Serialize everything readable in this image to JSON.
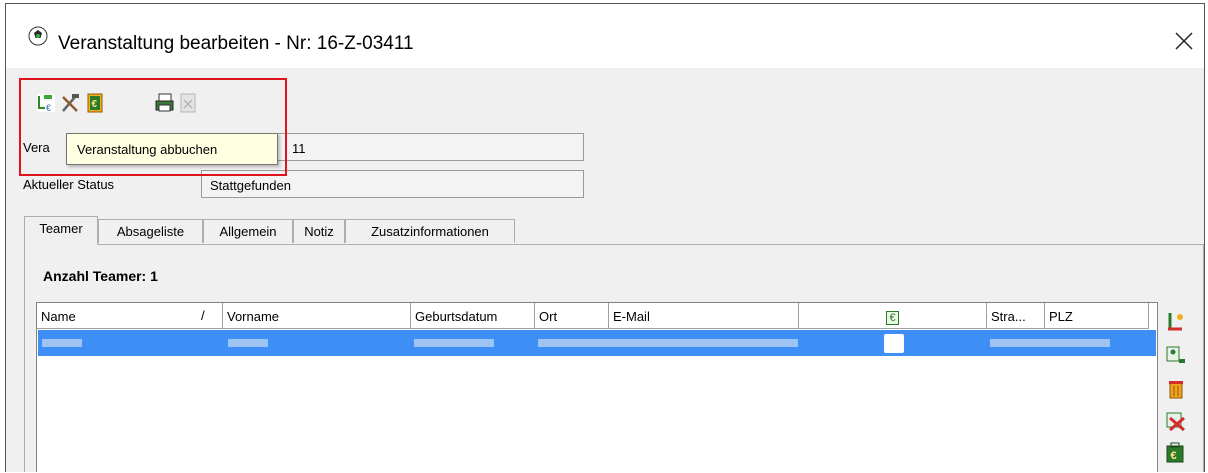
{
  "window": {
    "title": "Veranstaltung bearbeiten - Nr: 16-Z-03411",
    "close_icon": "close-icon"
  },
  "toolbar": {
    "icons": [
      "book-event-icon",
      "tools-icon",
      "euro-icon",
      "print-icon",
      "delete-disabled-icon"
    ],
    "tooltip": "Veranstaltung abbuchen"
  },
  "form": {
    "veranstaltung_label_partial": "Vera",
    "veranstaltung_value_partial": "11",
    "status_label": "Aktueller Status",
    "status_value": "Stattgefunden"
  },
  "tabs": [
    {
      "label": "Teamer",
      "active": true
    },
    {
      "label": "Absageliste",
      "active": false
    },
    {
      "label": "Allgemein",
      "active": false
    },
    {
      "label": "Notiz",
      "active": false
    },
    {
      "label": "Zusatzinformationen",
      "active": false
    }
  ],
  "teamer": {
    "count_label": "Anzahl Teamer: 1",
    "columns": [
      "Name",
      "Vorname",
      "Geburtsdatum",
      "Ort",
      "E-Mail",
      "€",
      "Stra...",
      "PLZ"
    ],
    "sort_indicator": "/",
    "rows": [
      {
        "selected": true,
        "values_redacted": true
      }
    ]
  },
  "side_actions": [
    "edit-icon",
    "export-user-icon",
    "trash-icon",
    "remove-icon",
    "cash-icon"
  ],
  "colors": {
    "highlight": "#e0141e",
    "selection": "#3d8ef5",
    "tooltip_bg": "#ffffe1"
  }
}
